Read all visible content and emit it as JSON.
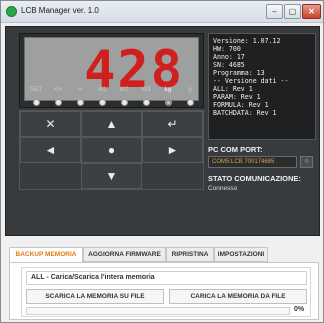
{
  "window": {
    "title": "LCB Manager ver. 1.0"
  },
  "window_controls": {
    "minimize": "–",
    "maximize": "▢",
    "close": "✕"
  },
  "display": {
    "value": "428"
  },
  "indicators": [
    {
      "label": "NET",
      "bold": false,
      "on": false
    },
    {
      "label": ">0<",
      "bold": false,
      "on": false
    },
    {
      "label": "><",
      "bold": false,
      "on": false
    },
    {
      "label": "W1",
      "bold": false,
      "on": false
    },
    {
      "label": "W2",
      "bold": false,
      "on": false
    },
    {
      "label": "W3",
      "bold": false,
      "on": false
    },
    {
      "label": "kg",
      "bold": true,
      "on": true
    },
    {
      "label": "g",
      "bold": false,
      "on": false
    }
  ],
  "keypad": {
    "zero": "✕",
    "up": "▲",
    "enter": "↵",
    "left": "◄",
    "center": "●",
    "right": "►",
    "down": "▼"
  },
  "info": {
    "lines": [
      "Versione: 1.07.12",
      "HW: 700",
      "Anno: 17",
      "SN: 4685",
      "Programma: 13",
      "",
      "-- Versione dati --",
      "ALL: Rev 1",
      "PARAM: Rev 1",
      "FORMULA: Rev 1",
      "BATCHDATA: Rev 1"
    ]
  },
  "connection": {
    "pc_com_port_label": "PC COM PORT:",
    "com_port_value": "COM5:LCB 700174685",
    "com_button_icon": "refresh-icon",
    "com_button_glyph": "○",
    "status_label": "STATO COMUNICAZIONE:",
    "status_value": "Connesso"
  },
  "tabs": [
    {
      "label": "BACKUP MEMORIA",
      "active": true
    },
    {
      "label": "AGGIORNA FIRMWARE",
      "active": false
    },
    {
      "label": "RIPRISTINA",
      "active": false
    },
    {
      "label": "IMPOSTAZIONI",
      "active": false
    }
  ],
  "backup": {
    "selected_operation": "ALL - Carica/Scarica l'intera memoria",
    "download_button": "SCARICA LA MEMORIA SU FILE",
    "upload_button": "CARICA LA MEMORIA DA FILE",
    "progress_percent": 0,
    "progress_text": "0%"
  },
  "colors": {
    "display_digits": "#cf1f1f",
    "active_tab": "#e07a10",
    "com_port_text": "#d9a24a"
  }
}
